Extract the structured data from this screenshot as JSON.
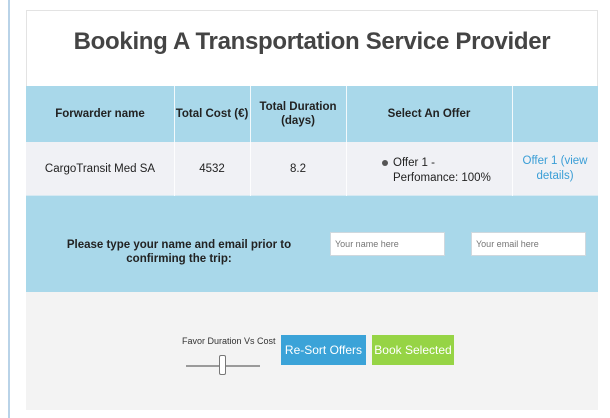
{
  "page": {
    "title": "Booking A Transportation Service Provider"
  },
  "table": {
    "columns": [
      "Forwarder name",
      "Total Cost (€)",
      "Total Duration\n(days)",
      "Select An Offer",
      ""
    ],
    "rows": [
      {
        "forwarder": "CargoTransit Med SA",
        "total_cost": "4532",
        "total_duration": "8.2",
        "offer_label": "Offer 1 -\nPerfomance: 100%",
        "offer_selected": true,
        "details_link": "Offer 1 (view\ndetails)"
      }
    ]
  },
  "confirm": {
    "prompt": "Please type your name and email prior to confirming the trip:",
    "name_placeholder": "Your name here",
    "email_placeholder": "Your email here"
  },
  "controls": {
    "slider_label": "Favor Duration Vs Cost",
    "resort_label": "Re-Sort Offers",
    "book_label": "Book Selected"
  },
  "colors": {
    "band_blue": "#a9d8ea",
    "resort_button": "#3ba3d8",
    "book_button": "#96d445",
    "link": "#3a9ed6"
  }
}
